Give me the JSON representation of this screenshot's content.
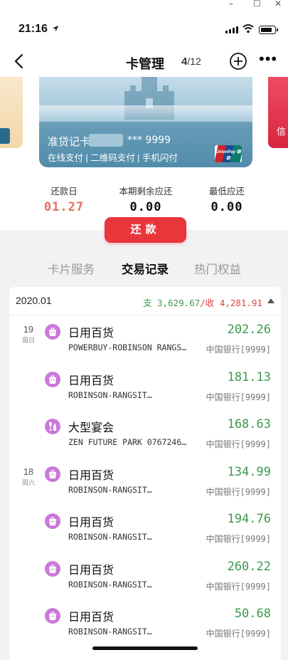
{
  "window": {
    "minimize": "–",
    "maximize": "☐",
    "close": "✕"
  },
  "status": {
    "time": "21:16",
    "location_icon": "location-arrow-icon"
  },
  "nav": {
    "title": "卡管理",
    "current": "4",
    "total": "/12"
  },
  "card": {
    "name": "准贷记卡",
    "number": "*** 9999",
    "features": "在线支付 | 二维码支付 | 手机闪付",
    "brand": "UnionPay 银联",
    "next_card_label": "信"
  },
  "stats": [
    {
      "label": "还款日",
      "value": "01.27",
      "color": "#e96d5f"
    },
    {
      "label": "本期剩余应还",
      "value": "0.00",
      "color": "#111111"
    },
    {
      "label": "最低应还",
      "value": "0.00",
      "color": "#111111"
    }
  ],
  "repay_label": "还款",
  "tabs": [
    "卡片服务",
    "交易记录",
    "热门权益"
  ],
  "active_tab": "交易记录",
  "records": {
    "month": "2020.01",
    "spend_label": "支",
    "spend": "3,629.67",
    "income_label": "/收",
    "income": "4,281.91",
    "items": [
      {
        "day": "19",
        "weekday": "周日",
        "icon": "shopping-bag-icon",
        "merchant": "日用百货",
        "desc": "POWERBUY-ROBINSON RANGS…",
        "amount": "202.26",
        "bank": "中国银行[9999]"
      },
      {
        "day": "",
        "weekday": "",
        "icon": "shopping-bag-icon",
        "merchant": "日用百货",
        "desc": "ROBINSON-RANGSIT…",
        "amount": "181.13",
        "bank": "中国银行[9999]"
      },
      {
        "day": "",
        "weekday": "",
        "icon": "wine-glass-icon",
        "merchant": "大型宴会",
        "desc": "ZEN FUTURE PARK 0767246…",
        "amount": "168.63",
        "bank": "中国银行[9999]"
      },
      {
        "day": "18",
        "weekday": "周六",
        "icon": "shopping-bag-icon",
        "merchant": "日用百货",
        "desc": "ROBINSON-RANGSIT…",
        "amount": "134.99",
        "bank": "中国银行[9999]"
      },
      {
        "day": "",
        "weekday": "",
        "icon": "shopping-bag-icon",
        "merchant": "日用百货",
        "desc": "ROBINSON-RANGSIT…",
        "amount": "194.76",
        "bank": "中国银行[9999]"
      },
      {
        "day": "",
        "weekday": "",
        "icon": "shopping-bag-icon",
        "merchant": "日用百货",
        "desc": "ROBINSON-RANGSIT…",
        "amount": "260.22",
        "bank": "中国银行[9999]"
      },
      {
        "day": "",
        "weekday": "",
        "icon": "shopping-bag-icon",
        "merchant": "日用百货",
        "desc": "ROBINSON-RANGSIT…",
        "amount": "50.68",
        "bank": "中国银行[9999]"
      }
    ]
  },
  "colors": {
    "accent": "#e8363b",
    "positive": "#3a9a4d",
    "category": "#c979d9"
  }
}
